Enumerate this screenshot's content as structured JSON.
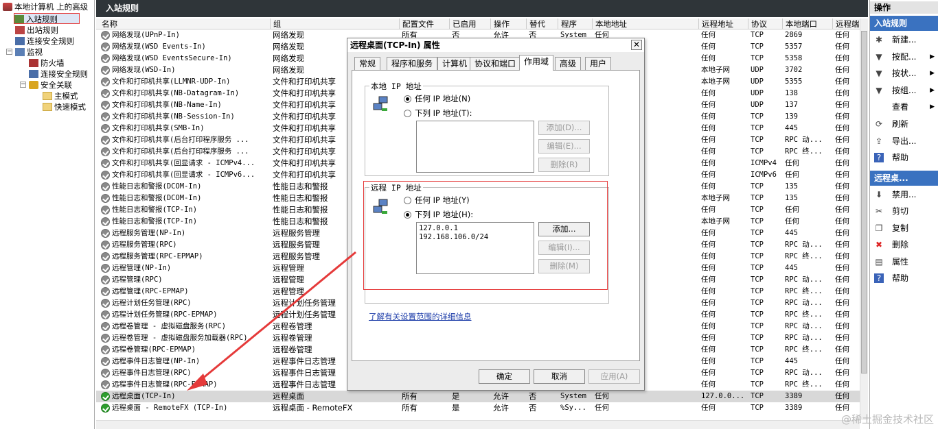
{
  "tree": {
    "root": "本地计算机 上的高级",
    "items": [
      "入站规则",
      "出站规则",
      "连接安全规则",
      "监视",
      "防火墙",
      "连接安全规则",
      "安全关联",
      "主模式",
      "快速模式"
    ]
  },
  "center": {
    "title": "入站规则",
    "columns": [
      "名称",
      "组",
      "配置文件",
      "已启用",
      "操作",
      "替代",
      "程序",
      "本地地址",
      "远程地址",
      "协议",
      "本地端口",
      "远程端"
    ],
    "rows": [
      {
        "name": "网络发现(UPnP-In)",
        "group": "网络发现",
        "profile": "所有",
        "enabled": "否",
        "action": "允许",
        "override": "否",
        "program": "System",
        "local": "任何",
        "remote": "任何",
        "proto": "TCP",
        "lport": "2869",
        "rport": "任何",
        "on": false
      },
      {
        "name": "网络发现(WSD Events-In)",
        "group": "网络发现",
        "profile": "",
        "enabled": "",
        "action": "",
        "override": "",
        "program": "",
        "local": "",
        "remote": "任何",
        "proto": "TCP",
        "lport": "5357",
        "rport": "任何",
        "on": false
      },
      {
        "name": "网络发现(WSD EventsSecure-In)",
        "group": "网络发现",
        "profile": "",
        "enabled": "",
        "action": "",
        "override": "",
        "program": "",
        "local": "",
        "remote": "任何",
        "proto": "TCP",
        "lport": "5358",
        "rport": "任何",
        "on": false
      },
      {
        "name": "网络发现(WSD-In)",
        "group": "网络发现",
        "profile": "",
        "enabled": "",
        "action": "",
        "override": "",
        "program": "",
        "local": "",
        "remote": "本地子网",
        "proto": "UDP",
        "lport": "3702",
        "rport": "任何",
        "on": false
      },
      {
        "name": "文件和打印机共享(LLMNR-UDP-In)",
        "group": "文件和打印机共享",
        "profile": "",
        "enabled": "",
        "action": "",
        "override": "",
        "program": "",
        "local": "",
        "remote": "本地子网",
        "proto": "UDP",
        "lport": "5355",
        "rport": "任何",
        "on": false
      },
      {
        "name": "文件和打印机共享(NB-Datagram-In)",
        "group": "文件和打印机共享",
        "profile": "",
        "enabled": "",
        "action": "",
        "override": "",
        "program": "",
        "local": "",
        "remote": "任何",
        "proto": "UDP",
        "lport": "138",
        "rport": "任何",
        "on": false
      },
      {
        "name": "文件和打印机共享(NB-Name-In)",
        "group": "文件和打印机共享",
        "profile": "",
        "enabled": "",
        "action": "",
        "override": "",
        "program": "",
        "local": "",
        "remote": "任何",
        "proto": "UDP",
        "lport": "137",
        "rport": "任何",
        "on": false
      },
      {
        "name": "文件和打印机共享(NB-Session-In)",
        "group": "文件和打印机共享",
        "profile": "",
        "enabled": "",
        "action": "",
        "override": "",
        "program": "",
        "local": "",
        "remote": "任何",
        "proto": "TCP",
        "lport": "139",
        "rport": "任何",
        "on": false
      },
      {
        "name": "文件和打印机共享(SMB-In)",
        "group": "文件和打印机共享",
        "profile": "",
        "enabled": "",
        "action": "",
        "override": "",
        "program": "",
        "local": "",
        "remote": "任何",
        "proto": "TCP",
        "lport": "445",
        "rport": "任何",
        "on": false
      },
      {
        "name": "文件和打印机共享(后台打印程序服务 ...",
        "group": "文件和打印机共享",
        "profile": "",
        "enabled": "",
        "action": "",
        "override": "",
        "program": "",
        "local": "",
        "remote": "任何",
        "proto": "TCP",
        "lport": "RPC 动...",
        "rport": "任何",
        "on": false
      },
      {
        "name": "文件和打印机共享(后台打印程序服务 ...",
        "group": "文件和打印机共享",
        "profile": "",
        "enabled": "",
        "action": "",
        "override": "",
        "program": "",
        "local": "",
        "remote": "任何",
        "proto": "TCP",
        "lport": "RPC 终...",
        "rport": "任何",
        "on": false
      },
      {
        "name": "文件和打印机共享(回显请求 - ICMPv4...",
        "group": "文件和打印机共享",
        "profile": "",
        "enabled": "",
        "action": "",
        "override": "",
        "program": "",
        "local": "",
        "remote": "任何",
        "proto": "ICMPv4",
        "lport": "任何",
        "rport": "任何",
        "on": false
      },
      {
        "name": "文件和打印机共享(回显请求 - ICMPv6...",
        "group": "文件和打印机共享",
        "profile": "",
        "enabled": "",
        "action": "",
        "override": "",
        "program": "",
        "local": "",
        "remote": "任何",
        "proto": "ICMPv6",
        "lport": "任何",
        "rport": "任何",
        "on": false
      },
      {
        "name": "性能日志和警报(DCOM-In)",
        "group": "性能日志和警报",
        "profile": "",
        "enabled": "",
        "action": "",
        "override": "",
        "program": "",
        "local": "",
        "remote": "任何",
        "proto": "TCP",
        "lport": "135",
        "rport": "任何",
        "on": false
      },
      {
        "name": "性能日志和警报(DCOM-In)",
        "group": "性能日志和警报",
        "profile": "",
        "enabled": "",
        "action": "",
        "override": "",
        "program": "",
        "local": "",
        "remote": "本地子网",
        "proto": "TCP",
        "lport": "135",
        "rport": "任何",
        "on": false
      },
      {
        "name": "性能日志和警报(TCP-In)",
        "group": "性能日志和警报",
        "profile": "",
        "enabled": "",
        "action": "",
        "override": "",
        "program": "",
        "local": "",
        "remote": "任何",
        "proto": "TCP",
        "lport": "任何",
        "rport": "任何",
        "on": false
      },
      {
        "name": "性能日志和警报(TCP-In)",
        "group": "性能日志和警报",
        "profile": "",
        "enabled": "",
        "action": "",
        "override": "",
        "program": "",
        "local": "",
        "remote": "本地子网",
        "proto": "TCP",
        "lport": "任何",
        "rport": "任何",
        "on": false
      },
      {
        "name": "远程服务管理(NP-In)",
        "group": "远程服务管理",
        "profile": "",
        "enabled": "",
        "action": "",
        "override": "",
        "program": "",
        "local": "",
        "remote": "任何",
        "proto": "TCP",
        "lport": "445",
        "rport": "任何",
        "on": false
      },
      {
        "name": "远程服务管理(RPC)",
        "group": "远程服务管理",
        "profile": "",
        "enabled": "",
        "action": "",
        "override": "",
        "program": "",
        "local": "",
        "remote": "任何",
        "proto": "TCP",
        "lport": "RPC 动...",
        "rport": "任何",
        "on": false
      },
      {
        "name": "远程服务管理(RPC-EPMAP)",
        "group": "远程服务管理",
        "profile": "",
        "enabled": "",
        "action": "",
        "override": "",
        "program": "",
        "local": "",
        "remote": "任何",
        "proto": "TCP",
        "lport": "RPC 终...",
        "rport": "任何",
        "on": false
      },
      {
        "name": "远程管理(NP-In)",
        "group": "远程管理",
        "profile": "",
        "enabled": "",
        "action": "",
        "override": "",
        "program": "",
        "local": "",
        "remote": "任何",
        "proto": "TCP",
        "lport": "445",
        "rport": "任何",
        "on": false
      },
      {
        "name": "远程管理(RPC)",
        "group": "远程管理",
        "profile": "",
        "enabled": "",
        "action": "",
        "override": "",
        "program": "",
        "local": "",
        "remote": "任何",
        "proto": "TCP",
        "lport": "RPC 动...",
        "rport": "任何",
        "on": false
      },
      {
        "name": "远程管理(RPC-EPMAP)",
        "group": "远程管理",
        "profile": "",
        "enabled": "",
        "action": "",
        "override": "",
        "program": "",
        "local": "",
        "remote": "任何",
        "proto": "TCP",
        "lport": "RPC 终...",
        "rport": "任何",
        "on": false
      },
      {
        "name": "远程计划任务管理(RPC)",
        "group": "远程计划任务管理",
        "profile": "",
        "enabled": "",
        "action": "",
        "override": "",
        "program": "",
        "local": "",
        "remote": "任何",
        "proto": "TCP",
        "lport": "RPC 动...",
        "rport": "任何",
        "on": false
      },
      {
        "name": "远程计划任务管理(RPC-EPMAP)",
        "group": "远程计划任务管理",
        "profile": "",
        "enabled": "",
        "action": "",
        "override": "",
        "program": "",
        "local": "",
        "remote": "任何",
        "proto": "TCP",
        "lport": "RPC 终...",
        "rport": "任何",
        "on": false
      },
      {
        "name": "远程卷管理 - 虚拟磁盘服务(RPC)",
        "group": "远程卷管理",
        "profile": "",
        "enabled": "",
        "action": "",
        "override": "",
        "program": "",
        "local": "",
        "remote": "任何",
        "proto": "TCP",
        "lport": "RPC 动...",
        "rport": "任何",
        "on": false
      },
      {
        "name": "远程卷管理 - 虚拟磁盘服务加载器(RPC)",
        "group": "远程卷管理",
        "profile": "",
        "enabled": "",
        "action": "",
        "override": "",
        "program": "",
        "local": "",
        "remote": "任何",
        "proto": "TCP",
        "lport": "RPC 动...",
        "rport": "任何",
        "on": false
      },
      {
        "name": "远程卷管理(RPC-EPMAP)",
        "group": "远程卷管理",
        "profile": "",
        "enabled": "",
        "action": "",
        "override": "",
        "program": "",
        "local": "",
        "remote": "任何",
        "proto": "TCP",
        "lport": "RPC 终...",
        "rport": "任何",
        "on": false
      },
      {
        "name": "远程事件日志管理(NP-In)",
        "group": "远程事件日志管理",
        "profile": "",
        "enabled": "",
        "action": "",
        "override": "",
        "program": "",
        "local": "",
        "remote": "任何",
        "proto": "TCP",
        "lport": "445",
        "rport": "任何",
        "on": false
      },
      {
        "name": "远程事件日志管理(RPC)",
        "group": "远程事件日志管理",
        "profile": "",
        "enabled": "",
        "action": "",
        "override": "",
        "program": "",
        "local": "",
        "remote": "任何",
        "proto": "TCP",
        "lport": "RPC 动...",
        "rport": "任何",
        "on": false
      },
      {
        "name": "远程事件日志管理(RPC-EPMAP)",
        "group": "远程事件日志管理",
        "profile": "",
        "enabled": "",
        "action": "",
        "override": "",
        "program": "",
        "local": "",
        "remote": "任何",
        "proto": "TCP",
        "lport": "RPC 终...",
        "rport": "任何",
        "on": false
      },
      {
        "name": "远程桌面(TCP-In)",
        "group": "远程桌面",
        "profile": "所有",
        "enabled": "是",
        "action": "允许",
        "override": "否",
        "program": "System",
        "local": "任何",
        "remote": "127.0.0...",
        "proto": "TCP",
        "lport": "3389",
        "rport": "任何",
        "on": true,
        "selected": true
      },
      {
        "name": "远程桌面 - RemoteFX (TCP-In)",
        "group": "远程桌面 - RemoteFX",
        "profile": "所有",
        "enabled": "是",
        "action": "允许",
        "override": "否",
        "program": "%Sy...",
        "local": "任何",
        "remote": "任何",
        "proto": "TCP",
        "lport": "3389",
        "rport": "任何",
        "on": true
      }
    ]
  },
  "actions": {
    "header": "操作",
    "section1": "入站规则",
    "items1": [
      "新建...",
      "按配...",
      "按状...",
      "按组...",
      "查看",
      "刷新",
      "导出...",
      "帮助"
    ],
    "section2": "远程桌...",
    "items2": [
      "禁用...",
      "剪切",
      "复制",
      "删除",
      "属性",
      "帮助"
    ]
  },
  "dialog": {
    "title": "远程桌面(TCP-In) 属性",
    "close": "✕",
    "tabs": [
      "常规",
      "程序和服务",
      "计算机",
      "协议和端口",
      "作用域",
      "高级",
      "用户"
    ],
    "active_tab": "作用域",
    "local": {
      "label": "本地 IP 地址",
      "any": "任何 IP 地址(N)",
      "list": "下列 IP 地址(T):",
      "entries": [],
      "add": "添加(D)...",
      "edit": "编辑(E)...",
      "remove": "删除(R)"
    },
    "remote": {
      "label": "远程 IP 地址",
      "any": "任何 IP 地址(Y)",
      "list": "下列 IP 地址(H):",
      "entries": [
        "127.0.0.1",
        "192.168.106.0/24"
      ],
      "add": "添加...",
      "edit": "编辑(I)...",
      "remove": "删除(M)"
    },
    "link": "了解有关设置范围的详细信息",
    "ok": "确定",
    "cancel": "取消",
    "apply": "应用(A)"
  },
  "watermark": "@稀土掘金技术社区",
  "colors": {
    "title_bar": "#2f3539",
    "section": "#3a72c0",
    "highlight": "#e53a3a",
    "enabled": "#2e9e2e"
  }
}
